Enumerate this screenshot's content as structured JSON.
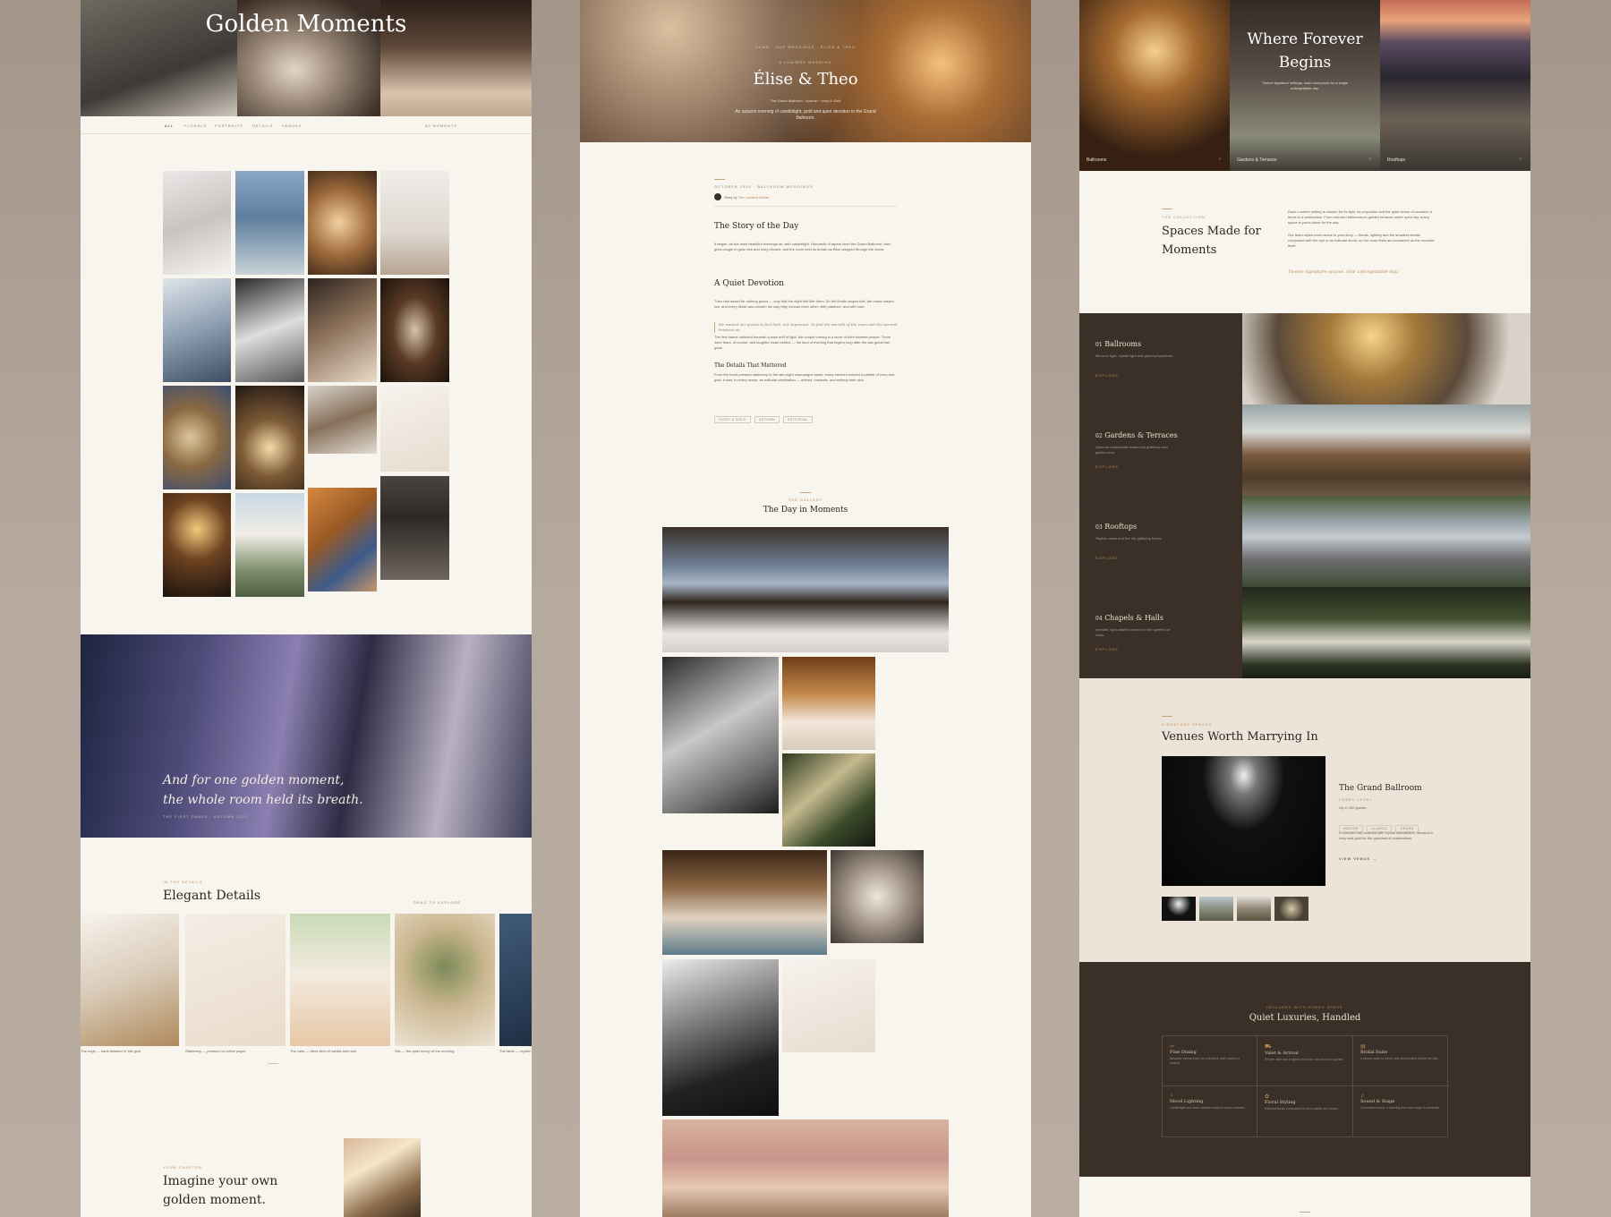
{
  "col1": {
    "hero_title": "Golden Moments",
    "nav": [
      "ALL",
      "FLORALS",
      "PORTRAITS",
      "DETAILS",
      "VENUES"
    ],
    "nav_count": "60 MOMENTS",
    "quote_line1": "And for one golden moment,",
    "quote_line2": "the whole room held its breath.",
    "quote_caption": "THE FIRST DANCE · AUTUMN 2024",
    "details_eyebrow": "IN THE DETAILS",
    "details_title": "Elegant Details",
    "drag_hint": "DRAG TO EXPLORE",
    "detail_captions": [
      "The rings — hand finished in 18k gold",
      "Stationery — pressed on cotton paper",
      "The cake — three tiers of vanilla and rose",
      "Silk — the quiet luxury of the morning",
      "The table — crystal"
    ],
    "cta_eyebrow": "YOUR CHAPTER",
    "cta_line1": "Imagine your own",
    "cta_line2": "golden moment."
  },
  "col2": {
    "breadcrumb": "HOME · OUR WEDDINGS · ÉLISE & THEO",
    "eyebrow": "A LUMIÈRE WEDDING",
    "title": "Élise & Theo",
    "meta": [
      "The Grand Ballroom",
      "Autumn",
      "Ivory & Gold"
    ],
    "intro": "An autumn evening of candlelight, gold and quiet devotion in the Grand Ballroom.",
    "date_tag": "OCTOBER 2024 · BALLROOM WEDDINGS",
    "story_by": "Story by",
    "author": "The Lumière Atelier",
    "h1": "The Story of the Day",
    "p1": "It began, as the most beautiful evenings do, with candlelight. Hundreds of tapers lined the Grand Ballroom, their glow caught in gold rims and ivory blooms, and the room held its breath as Élise stepped through the doors.",
    "h2": "A Quiet Devotion",
    "p2": "Theo had asked for nothing grand — only that the night feel like them. So the florals stayed soft, the music stayed low, and every detail was chosen the way they choose each other: with patience, and with care.",
    "pull": "We wanted our guests to feel held, not impressed. To feel the warmth of the room and the warmth between us.",
    "p3": "The first dance unfolded beneath a slow drift of light, the couple turning in a circle of their dearest people. There were tears, of course, and laughter close behind — the kind of evening that lingers long after the last guest has gone.",
    "h3": "The Details That Mattered",
    "p4": "From the hand-pressed stationery to the late-night champagne tower, every element echoed a palette of ivory and gold. It was, in every sense, an editorial celebration — refined, romantic, and entirely their own.",
    "tags": [
      "IVORY & GOLD",
      "AUTUMN",
      "EDITORIAL"
    ],
    "gallery_eyebrow": "THE GALLERY",
    "gallery_title": "The Day in Moments"
  },
  "col3": {
    "hero_title_1": "Where Forever",
    "hero_title_2": "Begins",
    "hero_sub": "Twelve signature settings, each composed for a single unforgettable day.",
    "hero_labels": [
      "Ballrooms",
      "Gardens & Terraces",
      "Rooftops"
    ],
    "coll_eyebrow": "THE COLLECTION",
    "coll_title_1": "Spaces Made for",
    "coll_title_2": "Moments",
    "coll_p1": "Each Lumière setting is chosen for its light, its proportion and the quiet sense of occasion it lends to a celebration. From mirrored ballrooms to garden terraces under open sky, every space is yours alone for the day.",
    "coll_p2": "Our team styles each venue to your story — florals, lighting and the smallest details composed with the eye of an editorial shoot, so the room feels as considered as the moment itself.",
    "coll_sig": "Twelve signature spaces. One unforgettable day.",
    "venues": [
      {
        "num": "01",
        "name": "Ballrooms",
        "desc": "Mirrored light, crystal light and grand proportions.",
        "cta": "EXPLORE"
      },
      {
        "num": "02",
        "name": "Gardens & Terraces",
        "desc": "Open air ceremonies framed by greenery and golden hour.",
        "cta": "EXPLORE"
      },
      {
        "num": "03",
        "name": "Rooftops",
        "desc": "Skyline views and the city glittering below.",
        "cta": "EXPLORE"
      },
      {
        "num": "04",
        "name": "Chapels & Halls",
        "desc": "Intimate, light-washed rooms for the quietest of vows.",
        "cta": "EXPLORE"
      }
    ],
    "sig_eyebrow": "SIGNATURE SPACES",
    "sig_title": "Venues Worth Marrying In",
    "feat_name": "The Grand Ballroom",
    "feat_level": "LOBBY LEVEL",
    "feat_cap": "Up to 300 guests",
    "feat_chips": [
      "INDOOR",
      "CLASSIC",
      "GRAND"
    ],
    "feat_desc": "A mirrored hall crowned with crystal chandeliers, dressed in ivory and gold for the grandest of celebrations.",
    "feat_cta": "VIEW VENUE",
    "lux_eyebrow": "INCLUDED WITH EVERY SPACE",
    "lux_title": "Quiet Luxuries, Handled",
    "amenities": [
      {
        "icon": "dining-icon",
        "name": "Fine Dining",
        "desc": "Bespoke menus from our executive chef, plated or shared."
      },
      {
        "icon": "car-icon",
        "name": "Valet & Arrival",
        "desc": "Private valet and a styled arrival for you and your guests."
      },
      {
        "icon": "suite-icon",
        "name": "Bridal Suite",
        "desc": "A serene suite to dress, rest and breathe before the day."
      },
      {
        "icon": "light-icon",
        "name": "Mood Lighting",
        "desc": "Candlelight and warm washes tuned to every moment."
      },
      {
        "icon": "flower-icon",
        "name": "Floral Styling",
        "desc": "Editorial florals composed for your palette and space."
      },
      {
        "icon": "music-icon",
        "name": "Sound & Stage",
        "desc": "Concealed sound, a dancing floor and stage to celebrate."
      }
    ]
  }
}
